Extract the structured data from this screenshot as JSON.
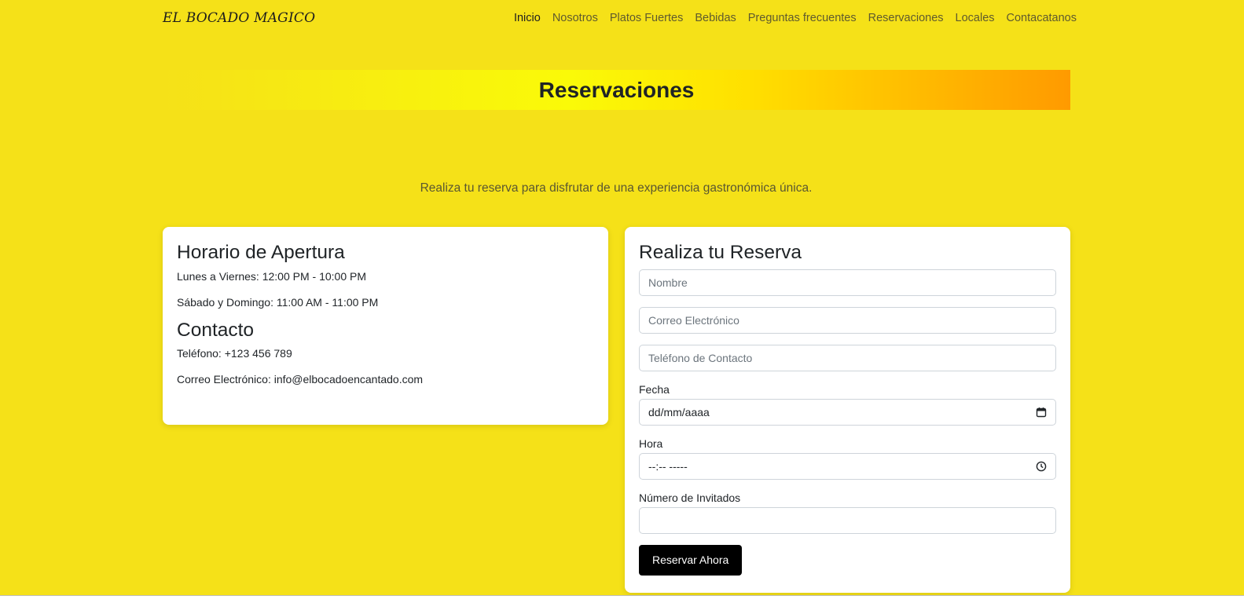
{
  "header": {
    "brand": "EL BOCADO MAGICO",
    "nav": [
      "Inicio",
      "Nosotros",
      "Platos Fuertes",
      "Bebidas",
      "Preguntas frecuentes",
      "Reservaciones",
      "Locales",
      "Contacatanos"
    ],
    "active": "Inicio"
  },
  "banner": {
    "title": "Reservaciones"
  },
  "intro": "Realiza tu reserva para disfrutar de una experiencia gastronómica única.",
  "info_card": {
    "hours_title": "Horario de Apertura",
    "weekday_hours": "Lunes a Viernes: 12:00 PM - 10:00 PM",
    "weekend_hours": "Sábado y Domingo: 11:00 AM - 11:00 PM",
    "contact_title": "Contacto",
    "phone": "Teléfono: +123 456 789",
    "email": "Correo Electrónico: info@elbocadoencantado.com"
  },
  "form": {
    "title": "Realiza tu Reserva",
    "name_placeholder": "Nombre",
    "email_placeholder": "Correo Electrónico",
    "phone_placeholder": "Teléfono de Contacto",
    "date_label": "Fecha",
    "date_value": "dd/mm/aaaa",
    "date_icon": "calendar-icon",
    "time_label": "Hora",
    "time_value": "--:-- -----",
    "time_icon": "clock-icon",
    "guests_label": "Número de Invitados",
    "guests_value": "",
    "submit_label": "Reservar Ahora"
  },
  "colors": {
    "page_background": "#f5e118",
    "banner_gradient_start": "#fafa08",
    "banner_gradient_end": "#ff9a00",
    "button_background": "#000000"
  }
}
